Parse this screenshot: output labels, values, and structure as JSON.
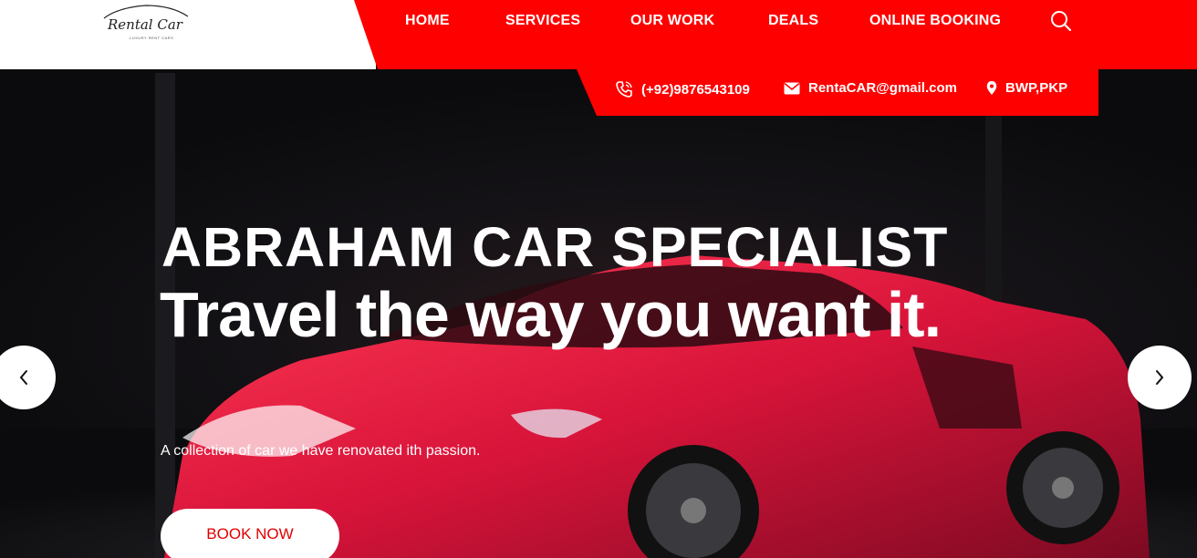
{
  "logo": {
    "brand": "Rental Car",
    "tagline": "LUXURY RENT CARS"
  },
  "nav": {
    "items": [
      {
        "label": "HOME"
      },
      {
        "label": "SERVICES"
      },
      {
        "label": "OUR WORK"
      },
      {
        "label": "DEALS"
      },
      {
        "label": "ONLINE BOOKING"
      }
    ],
    "search_icon": "search-icon"
  },
  "contact": {
    "phone": "(+92)9876543109",
    "email": "RentaCAR@gmail.com",
    "location": "BWP,PKP",
    "icons": [
      "phone-icon",
      "envelope-icon",
      "map-pin-icon"
    ]
  },
  "hero": {
    "eyebrow": "ABRAHAM CAR SPECIALIST",
    "headline": "Travel the way you want it.",
    "subtext": "A collection of car we have renovated ith passion.",
    "cta": "BOOK NOW"
  },
  "colors": {
    "accent": "#ff0000",
    "cta_text": "#e10000",
    "background": "#0d0d10"
  }
}
